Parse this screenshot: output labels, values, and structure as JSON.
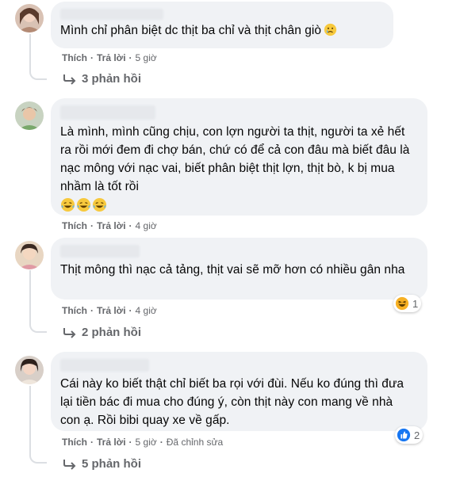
{
  "comments": [
    {
      "text": "Mình chỉ phân biệt dc thịt ba chỉ và thịt chân giò",
      "text_emoji": "crying-face-emoji",
      "actions": {
        "like": "Thích",
        "reply": "Trả lời",
        "time": "5 giờ"
      },
      "replies": "3 phản hồi"
    },
    {
      "text": "Là mình, mình cũng chịu, con lợn người ta thịt, người ta xẻ hết ra rồi mới đem đi chợ bán, chứ có để cả con đâu mà biết đâu là nạc mông với nạc vai, biết phân biệt thịt lợn, thịt bò, k bị mua nhầm là tốt rồi",
      "emojis": [
        "laughing-tears-emoji",
        "laughing-tears-emoji",
        "laughing-tears-emoji"
      ],
      "actions": {
        "like": "Thích",
        "reply": "Trả lời",
        "time": "4 giờ"
      }
    },
    {
      "text": "Thịt mông thì nạc cả tảng, thịt vai sẽ mỡ hơn có nhiều gân nha",
      "actions": {
        "like": "Thích",
        "reply": "Trả lời",
        "time": "4 giờ"
      },
      "reaction": {
        "icon": "haha-reaction-icon",
        "count": "1"
      },
      "replies": "2 phản hồi"
    },
    {
      "text": "Cái này ko biết thật chỉ biết ba rọi với đùi. Nếu ko đúng thì đưa lại tiền bác đi mua cho đúng ý, còn thịt này con mang về nhà con ạ. Rồi bibi quay xe về gấp.",
      "actions": {
        "like": "Thích",
        "reply": "Trả lời",
        "time": "5 giờ",
        "edited": "Đã chỉnh sửa"
      },
      "reaction": {
        "icon": "like-reaction-icon",
        "count": "2"
      },
      "replies": "5 phản hồi"
    }
  ],
  "colors": {
    "bubble": "#f0f2f5",
    "secondary_text": "#65676b",
    "like_blue": "#1877f2",
    "haha_yellow": "#f7b125"
  }
}
